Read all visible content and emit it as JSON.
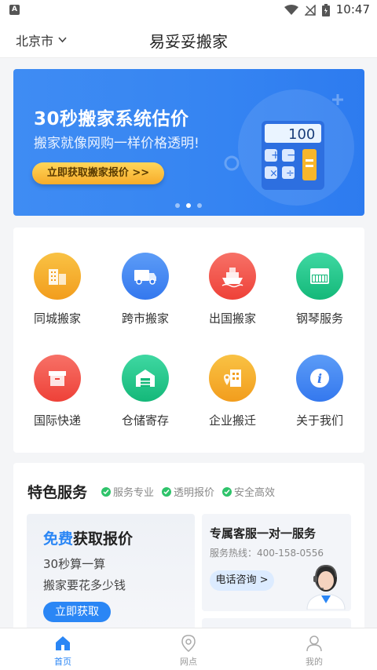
{
  "status_bar": {
    "time": "10:47",
    "app_indicator": "A"
  },
  "header": {
    "city": "北京市",
    "title": "易妥妥搬家"
  },
  "banner": {
    "title": "30秒搬家系统估价",
    "subtitle": "搬家就像网购一样价格透明!",
    "button": "立即获取搬家报价 >>",
    "calculator_display": "100"
  },
  "services": [
    {
      "label": "同城搬家",
      "icon": "buildings-icon",
      "color": "#f5a623"
    },
    {
      "label": "跨市搬家",
      "icon": "truck-icon",
      "color": "#3f84f2"
    },
    {
      "label": "出国搬家",
      "icon": "ship-icon",
      "color": "#f2554a"
    },
    {
      "label": "钢琴服务",
      "icon": "piano-icon",
      "color": "#23c28a"
    },
    {
      "label": "国际快递",
      "icon": "package-icon",
      "color": "#f2554a"
    },
    {
      "label": "仓储寄存",
      "icon": "warehouse-icon",
      "color": "#23c28a"
    },
    {
      "label": "企业搬迁",
      "icon": "office-icon",
      "color": "#f5a623"
    },
    {
      "label": "关于我们",
      "icon": "info-icon",
      "color": "#3f84f2"
    }
  ],
  "features": {
    "title": "特色服务",
    "tags": [
      "服务专业",
      "透明报价",
      "安全高效"
    ],
    "quote_card": {
      "title_highlight": "免费",
      "title_rest": "获取报价",
      "line1": "30秒算一算",
      "line2": "搬家要花多少钱",
      "button": "立即获取"
    },
    "service_card": {
      "title": "专属客服一对一服务",
      "hotline": "服务热线：400-158-0556",
      "button": "电话咨询 >"
    }
  },
  "tabbar": [
    {
      "label": "首页",
      "active": true
    },
    {
      "label": "网点",
      "active": false
    },
    {
      "label": "我的",
      "active": false
    }
  ],
  "colors": {
    "accent": "#2a86f5",
    "banner_bg": "#3584f2",
    "check": "#2ec36a"
  }
}
